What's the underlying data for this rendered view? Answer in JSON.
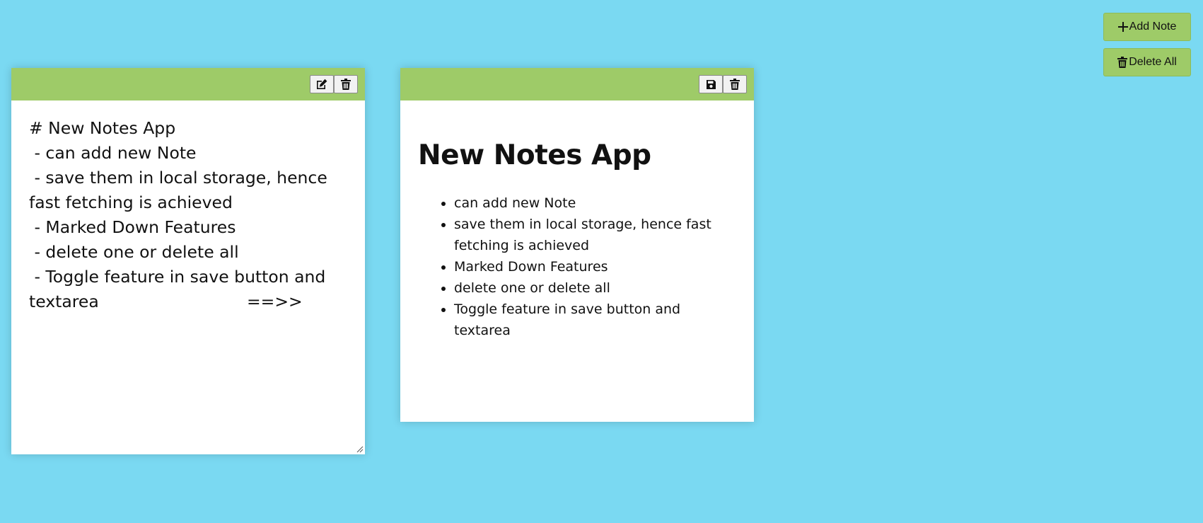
{
  "toolbar": {
    "add_note_label": "Add Note",
    "delete_all_label": "Delete All"
  },
  "notes": [
    {
      "mode": "edit",
      "text": "# New Notes App\n - can add new Note\n - save them in local storage, hence fast fetching is achieved\n - Marked Down Features\n - delete one or delete all\n - Toggle feature in save button and textarea                            ==>>"
    },
    {
      "mode": "preview",
      "heading": "New Notes App",
      "items": [
        "can add new Note",
        "save them in local storage, hence fast fetching is achieved",
        "Marked Down Features",
        "delete one or delete all",
        "Toggle feature in save button and textarea"
      ]
    }
  ],
  "colors": {
    "background": "#7ad9f2",
    "accent": "#9ecb68"
  }
}
